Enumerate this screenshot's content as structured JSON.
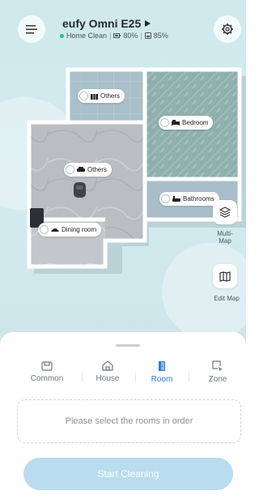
{
  "header": {
    "device_name": "eufy Omni E25",
    "status_text": "Home Clean",
    "battery": "80%",
    "water": "85%"
  },
  "map": {
    "rooms": [
      {
        "label": "Others",
        "icon": "storage-icon"
      },
      {
        "label": "Bedroom",
        "icon": "bed-icon"
      },
      {
        "label": "Others",
        "icon": "sofa-icon"
      },
      {
        "label": "Bathrooms",
        "icon": "bathtub-icon"
      },
      {
        "label": "Dining room",
        "icon": "dining-icon"
      }
    ]
  },
  "side_buttons": {
    "multi_map": "Multi-\nMap",
    "edit_map": "Edit Map"
  },
  "tabs": [
    {
      "label": "Common",
      "icon": "common-icon"
    },
    {
      "label": "House",
      "icon": "house-icon"
    },
    {
      "label": "Room",
      "icon": "room-door-icon",
      "active": true
    },
    {
      "label": "Zone",
      "icon": "zone-icon"
    }
  ],
  "room_select_placeholder": "Please select the rooms in order",
  "start_button": "Start Cleaning",
  "colors": {
    "accent": "#2c7ecf",
    "start_button_bg": "#b9dcef",
    "status_dot": "#27c27a"
  }
}
